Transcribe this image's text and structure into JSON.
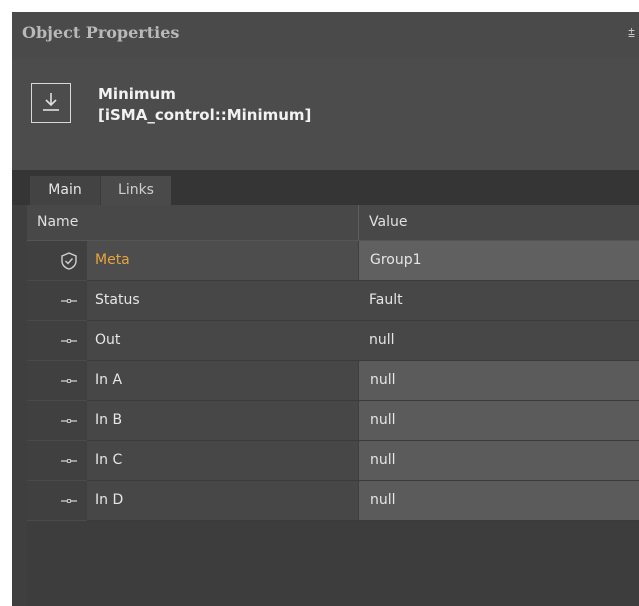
{
  "panel": {
    "title": "Object Properties",
    "pin_glyph": "⩲"
  },
  "object": {
    "icon": "download-icon",
    "name": "Minimum",
    "type": "[iSMA_control::Minimum]"
  },
  "tabs": [
    {
      "label": "Main",
      "active": true
    },
    {
      "label": "Links",
      "active": false
    }
  ],
  "grid": {
    "columns": {
      "name": "Name",
      "value": "Value"
    },
    "rows": [
      {
        "name": "Meta",
        "value": "Group1",
        "icon": "shield-check-icon"
      },
      {
        "name": "Status",
        "value": "Fault",
        "icon": "slot-connector-icon"
      },
      {
        "name": "Out",
        "value": "null",
        "icon": "slot-connector-icon"
      },
      {
        "name": "In A",
        "value": "null",
        "icon": "slot-connector-icon"
      },
      {
        "name": "In B",
        "value": "null",
        "icon": "slot-connector-icon"
      },
      {
        "name": "In C",
        "value": "null",
        "icon": "slot-connector-icon"
      },
      {
        "name": "In D",
        "value": "null",
        "icon": "slot-connector-icon"
      }
    ]
  },
  "colors": {
    "panel_bg": "#3f3f3f",
    "meta_accent": "#e8a33b",
    "text": "#e6e6e6"
  }
}
